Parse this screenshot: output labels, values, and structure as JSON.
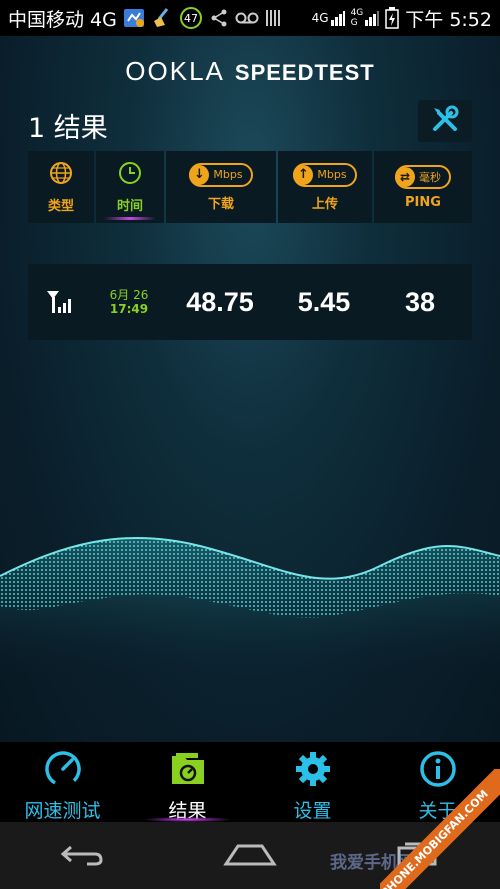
{
  "status_bar": {
    "carrier": "中国移动 4G",
    "notif_badge": "47",
    "net_left": "4G",
    "net_right_top": "4G",
    "net_right_bottom": "G",
    "time": "下午 5:52"
  },
  "app": {
    "logo_brand": "OOKLA",
    "logo_product": "SPEEDTEST",
    "result_count_label": "1 结果",
    "colors": {
      "accent": "#f0a41c",
      "green": "#8ad020",
      "cyan": "#2cc0e8",
      "purple": "#c04cd8"
    }
  },
  "columns": [
    {
      "label": "类型",
      "icon": "globe-icon"
    },
    {
      "label": "时间",
      "icon": "clock-icon"
    },
    {
      "label": "下载",
      "unit": "Mbps",
      "icon": "download-arrow-icon"
    },
    {
      "label": "上传",
      "unit": "Mbps",
      "icon": "upload-arrow-icon"
    },
    {
      "label": "PING",
      "unit": "毫秒",
      "icon": "swap-arrows-icon"
    }
  ],
  "results": [
    {
      "type_icon": "cellular-signal-icon",
      "date": "6月 26",
      "time": "17:49",
      "download": "48.75",
      "upload": "5.45",
      "ping": "38"
    }
  ],
  "bottom_nav": [
    {
      "label": "网速测试",
      "icon": "speedometer-icon"
    },
    {
      "label": "结果",
      "icon": "results-folder-icon",
      "active": true
    },
    {
      "label": "设置",
      "icon": "gear-icon"
    },
    {
      "label": "关于",
      "icon": "info-icon"
    }
  ],
  "watermark": {
    "ribbon": "PHONE.MOBIGFAN.COM",
    "text": "我爱手机网"
  }
}
